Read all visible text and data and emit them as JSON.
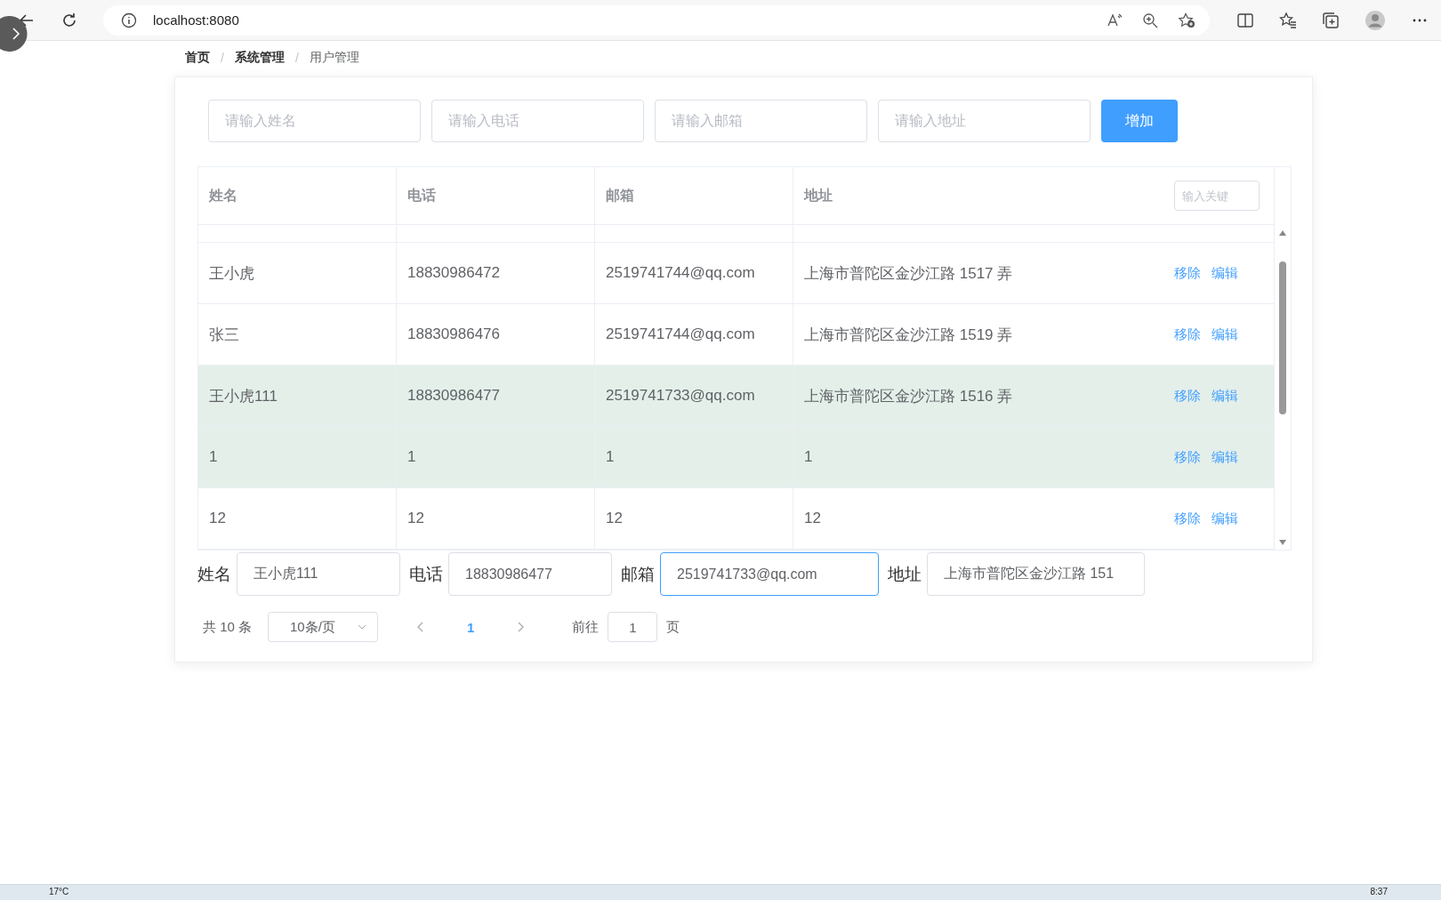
{
  "browser": {
    "url": "localhost:8080"
  },
  "breadcrumb_separator": "/",
  "breadcrumb": [
    {
      "label": "首页",
      "current": false
    },
    {
      "label": "系统管理",
      "current": false
    },
    {
      "label": "用户管理",
      "current": true
    }
  ],
  "add_form": {
    "fields": [
      {
        "placeholder": "请输入姓名"
      },
      {
        "placeholder": "请输入电话"
      },
      {
        "placeholder": "请输入邮箱"
      },
      {
        "placeholder": "请输入地址"
      }
    ],
    "button": "增加"
  },
  "table": {
    "columns": [
      "姓名",
      "电话",
      "邮箱",
      "地址"
    ],
    "search_placeholder": "输入关键",
    "rows": [
      {
        "cells": [
          "王小虎",
          "18830986472",
          "2519741744@qq.com",
          "上海市普陀区金沙江路 1517 弄"
        ],
        "highlighted": false,
        "actions": [
          "移除",
          "编辑"
        ]
      },
      {
        "cells": [
          "张三",
          "18830986476",
          "2519741744@qq.com",
          "上海市普陀区金沙江路 1519 弄"
        ],
        "highlighted": false,
        "actions": [
          "移除",
          "编辑"
        ]
      },
      {
        "cells": [
          "王小虎111",
          "18830986477",
          "2519741733@qq.com",
          "上海市普陀区金沙江路 1516 弄"
        ],
        "highlighted": true,
        "actions": [
          "移除",
          "编辑"
        ]
      },
      {
        "cells": [
          "1",
          "1",
          "1",
          "1"
        ],
        "highlighted": true,
        "actions": [
          "移除",
          "编辑"
        ]
      },
      {
        "cells": [
          "12",
          "12",
          "12",
          "12"
        ],
        "highlighted": false,
        "actions": [
          "移除",
          "编辑"
        ]
      }
    ]
  },
  "edit_form": [
    {
      "label": "姓名",
      "value": "王小虎111",
      "focused": false
    },
    {
      "label": "电话",
      "value": "18830986477",
      "focused": false
    },
    {
      "label": "邮箱",
      "value": "2519741733@qq.com",
      "focused": true
    },
    {
      "label": "地址",
      "value": "上海市普陀区金沙江路 151",
      "focused": false
    }
  ],
  "pagination": {
    "total": "共 10 条",
    "page_size": "10条/页",
    "pages": [
      {
        "label": "1",
        "selected": true
      }
    ],
    "goto_label": "前往",
    "goto_value": "1",
    "goto_suffix": "页"
  },
  "taskbar": {
    "weather": "17°C",
    "clock": "8:37"
  }
}
